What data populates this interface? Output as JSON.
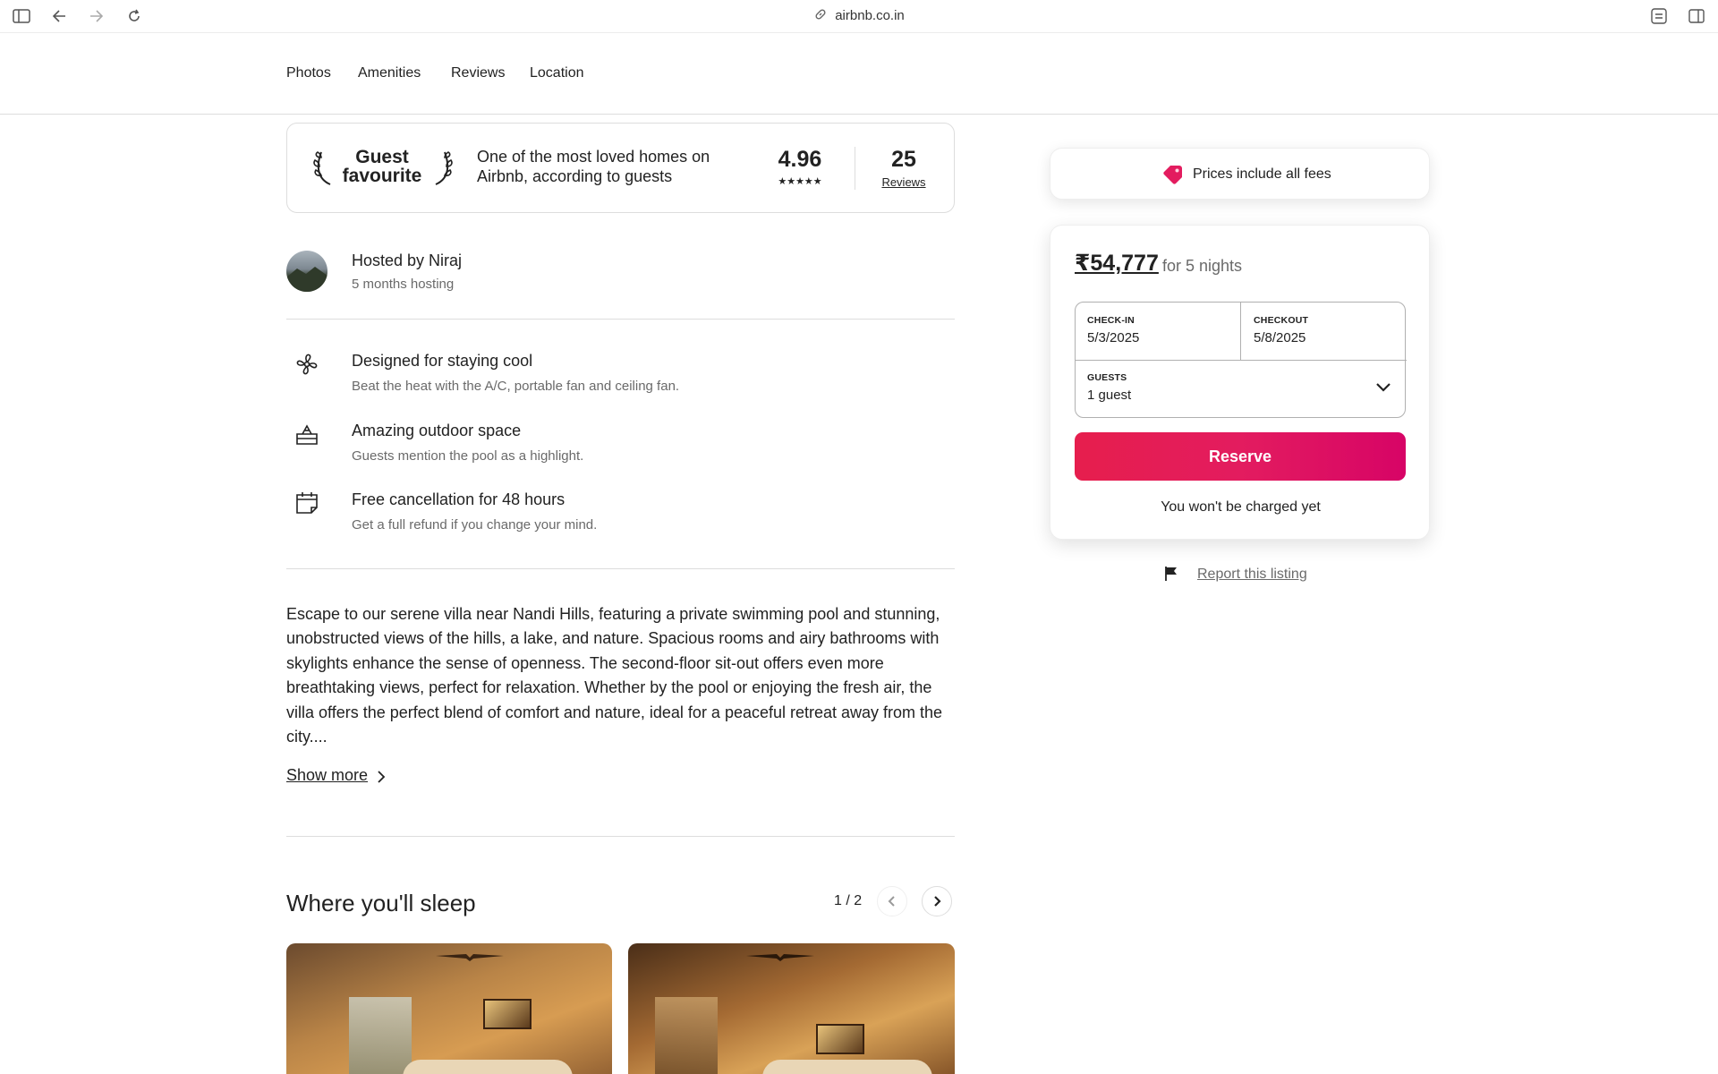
{
  "browser": {
    "url": "airbnb.co.in",
    "icons": [
      "sidebar-icon",
      "back-arrow-icon",
      "forward-arrow-icon",
      "reload-icon",
      "link-icon",
      "translate-icon",
      "split-view-icon"
    ]
  },
  "subnav": {
    "tabs": [
      {
        "label": "Photos"
      },
      {
        "label": "Amenities"
      },
      {
        "label": "Reviews"
      },
      {
        "label": "Location"
      }
    ]
  },
  "guest_favourite": {
    "title": "Guest favourite",
    "description": "One of the most loved homes on Airbnb, according to guests",
    "rating": "4.96",
    "stars": "★★★★★",
    "review_count": "25",
    "reviews_label": "Reviews"
  },
  "host": {
    "name": "Hosted by Niraj",
    "tenure": "5 months hosting"
  },
  "highlights": [
    {
      "icon": "fan-icon",
      "title": "Designed for staying cool",
      "subtitle": "Beat the heat with the A/C, portable fan and ceiling fan."
    },
    {
      "icon": "pool-icon",
      "title": "Amazing outdoor space",
      "subtitle": "Guests mention the pool as a highlight."
    },
    {
      "icon": "calendar-icon",
      "title": "Free cancellation for 48 hours",
      "subtitle": "Get a full refund if you change your mind."
    }
  ],
  "description": {
    "text": "Escape to our serene villa near Nandi Hills, featuring a private swimming pool and stunning, unobstructed views of the hills, a lake, and nature. Spacious rooms and airy bathrooms with skylights enhance the sense of openness. The second-floor sit-out offers even more breathtaking views, perfect for relaxation. Whether by the pool or enjoying the fresh air, the villa offers the perfect blend of comfort and nature, ideal for a peaceful retreat away from the city....",
    "show_more": "Show more"
  },
  "sleep": {
    "title": "Where you'll sleep",
    "pager": "1 / 2"
  },
  "fees_notice": "Prices include all fees",
  "booking": {
    "price": "₹54,777",
    "price_suffix": "for 5 nights",
    "checkin_label": "CHECK-IN",
    "checkin_value": "5/3/2025",
    "checkout_label": "CHECKOUT",
    "checkout_value": "5/8/2025",
    "guests_label": "GUESTS",
    "guests_value": "1 guest",
    "reserve_label": "Reserve",
    "no_charge": "You won't be charged yet"
  },
  "report_link": "Report this listing",
  "colors": {
    "brand": "#e31c5f",
    "text": "#222222",
    "muted": "#6a6a6a",
    "border": "#dddddd"
  }
}
